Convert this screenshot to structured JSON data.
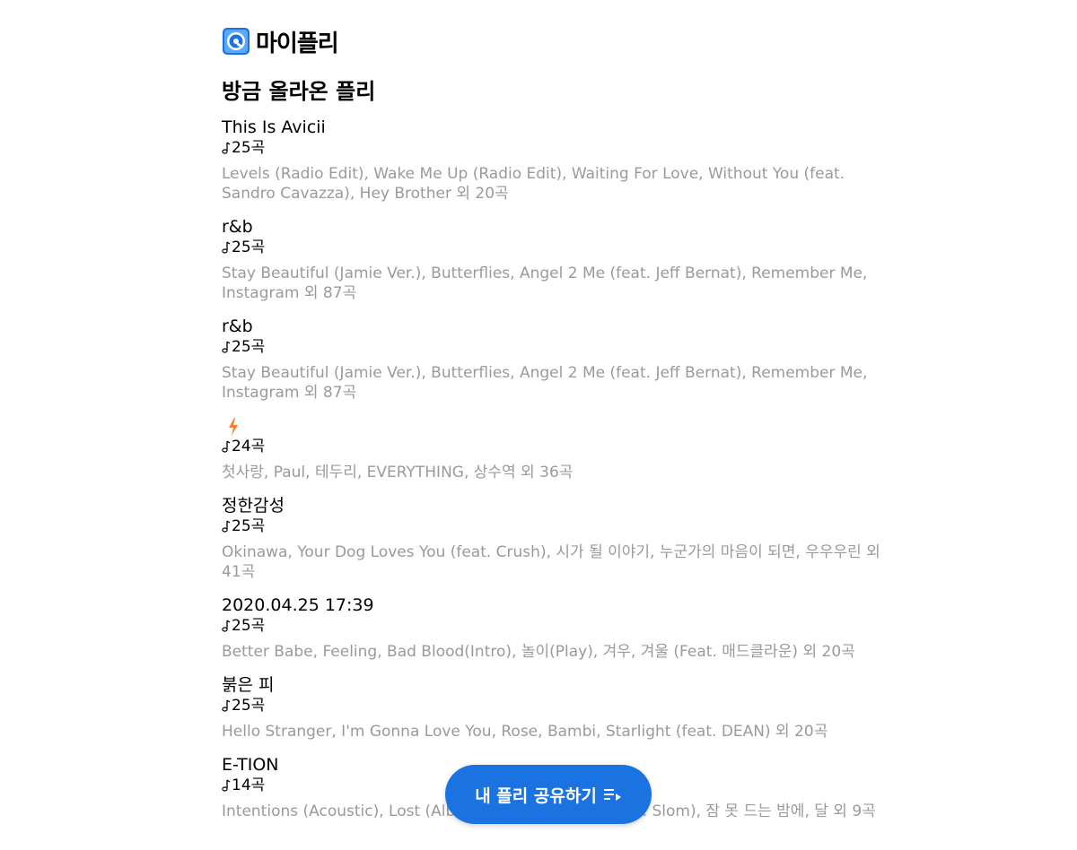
{
  "app": {
    "logo_text": "마이플리"
  },
  "section": {
    "title": "방금 올라온 플리"
  },
  "playlists": [
    {
      "title": "This Is Avicii",
      "count": "25곡",
      "tracks": "Levels (Radio Edit), Wake Me Up (Radio Edit), Waiting For Love, Without You (feat. Sandro Cavazza), Hey Brother 외 20곡"
    },
    {
      "title": "r&b",
      "count": "25곡",
      "tracks": "Stay Beautiful (Jamie Ver.), Butterflies, Angel 2 Me (feat. Jeff Bernat), Remember Me, Instagram 외 87곡"
    },
    {
      "title": "r&b",
      "count": "25곡",
      "tracks": "Stay Beautiful (Jamie Ver.), Butterflies, Angel 2 Me (feat. Jeff Bernat), Remember Me, Instagram 외 87곡"
    },
    {
      "title": "",
      "title_icon": "lightning-bolt-icon",
      "count": "24곡",
      "tracks": "첫사랑, Paul, 테두리, EVERYTHING, 상수역 외 36곡"
    },
    {
      "title": "정한감성",
      "count": "25곡",
      "tracks": "Okinawa, Your Dog Loves You (feat. Crush), 시가 될 이야기, 누군가의 마음이 되면, 우우우린 외 41곡"
    },
    {
      "title": "2020.04.25 17:39",
      "count": "25곡",
      "tracks": "Better Babe, Feeling, Bad Blood(Intro), 놀이(Play), 겨우, 겨울 (Feat. 매드클라운) 외 20곡"
    },
    {
      "title": "붉은 피",
      "count": "25곡",
      "tracks": "Hello Stranger, I'm Gonna Love You, Rose, Bambi, Starlight (feat. DEAN) 외 20곡"
    },
    {
      "title": "E-TION",
      "count": "14곡",
      "tracks": "Intentions (Acoustic), Lost (Album Version), Freak (Prod. Slom), 잠 못 드는 밤에, 달 외 9곡"
    }
  ],
  "share_button": {
    "label": "내 플리 공유하기",
    "icon": "playlist-queue-icon"
  },
  "colors": {
    "accent": "#1b73e2",
    "muted_text": "#9a9a9a",
    "bolt": "#f5812a"
  }
}
